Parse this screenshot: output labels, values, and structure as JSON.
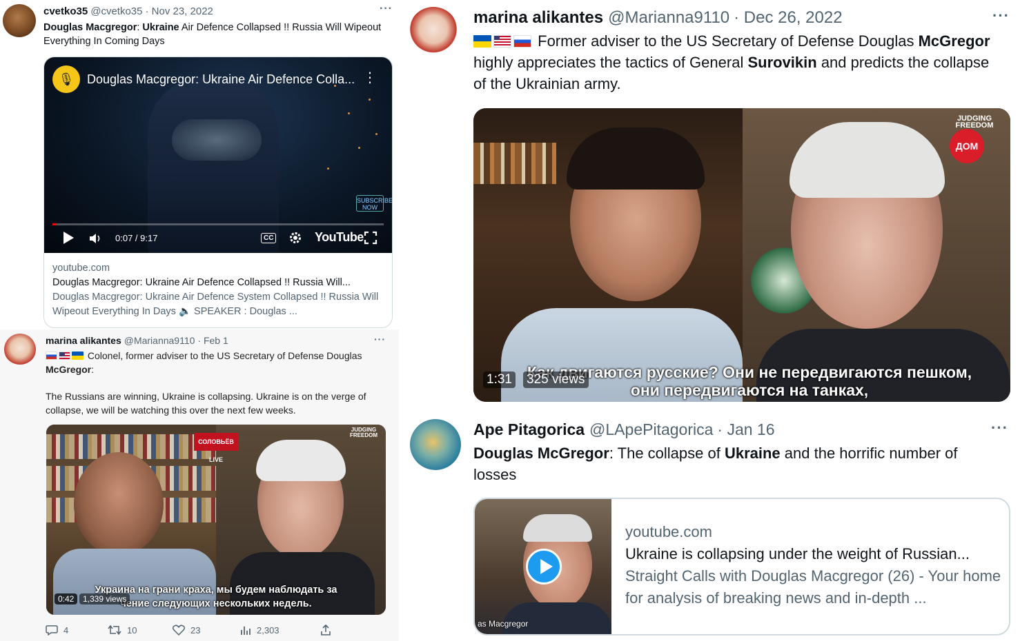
{
  "tweet1": {
    "name": "cvetko35",
    "handle": "@cvetko35",
    "date": "· Nov 23, 2022",
    "more": "···",
    "text_bold_1": "Douglas Macgregor",
    "text_plain_1": ": ",
    "text_bold_2": "Ukraine",
    "text_plain_2": " Air Defence Collapsed !! Russia Will Wipeout Everything In Coming Days",
    "card": {
      "video_title": "Douglas Macgregor: Ukraine Air Defence Colla...",
      "kebab": "⋮",
      "subscribe": "SUBSCRIBE NOW",
      "time": "0:07 / 9:17",
      "progress": 0.013,
      "youtube_label": "YouTube",
      "cc_label": "CC",
      "domain": "youtube.com",
      "title": "Douglas Macgregor: Ukraine Air Defence Collapsed !! Russia Will...",
      "description": "Douglas Macgregor: Ukraine Air Defence System Collapsed !! Russia Will Wipeout Everything In Days 🔈 SPEAKER : Douglas ..."
    }
  },
  "tweet2": {
    "name": "marina alikantes",
    "handle": "@Marianna9110",
    "date": "· Feb 1",
    "more": "···",
    "text_line1": "Colonel, former adviser to the US Secretary of Defense Douglas",
    "text_bold": "McGregor",
    "text_colon": ":",
    "text_para2": "The Russians are winning, Ukraine is collapsing.  Ukraine is on the verge of collapse, we will be watching this over the next few weeks.",
    "video": {
      "logo_left": "СОЛОВЬЁВ LIVE",
      "logo_right": "JUDGING FREEDOM",
      "subtitle_line1": "Украина на грани краха, мы будем наблюдать за",
      "subtitle_line2": "чение следующих нескольких недель.",
      "duration": "0:42",
      "views": "1,339 views"
    },
    "actions": {
      "replies": "4",
      "retweets": "10",
      "likes": "23",
      "views": "2,303"
    }
  },
  "tweet3": {
    "name": "marina alikantes",
    "handle": "@Marianna9110",
    "date": "· Dec 26, 2022",
    "more": "···",
    "text_plain_1": "Former adviser to the US Secretary of Defense Douglas",
    "text_bold_1": "McGregor",
    "text_plain_2": " highly appreciates the tactics of General ",
    "text_bold_2": "Surovikin",
    "text_plain_3": " and predicts the collapse of the Ukrainian army.",
    "video": {
      "logo_top": "JUDGING FREEDOM",
      "logo_dom": "ДОМ",
      "subtitle_line1": "Как двигаются русские? Они не передвигаются пешком,",
      "subtitle_line2": "они передвигаются на танках,",
      "duration": "1:31",
      "views": "325 views"
    }
  },
  "tweet4": {
    "name": "Ape Pitagorica",
    "handle": "@LApePitagorica",
    "date": "· Jan 16",
    "more": "···",
    "text_bold_1": "Douglas McGregor",
    "text_plain_1": ": The collapse of ",
    "text_bold_2": "Ukraine",
    "text_plain_2": " and the horrific number of losses",
    "card": {
      "domain": "youtube.com",
      "title": "Ukraine is collapsing under the weight of Russian...",
      "description": "Straight Calls with Douglas Macgregor (26) - Your home for analysis of breaking news and in-depth ...",
      "thumb_caption": "as Macgregor"
    }
  }
}
